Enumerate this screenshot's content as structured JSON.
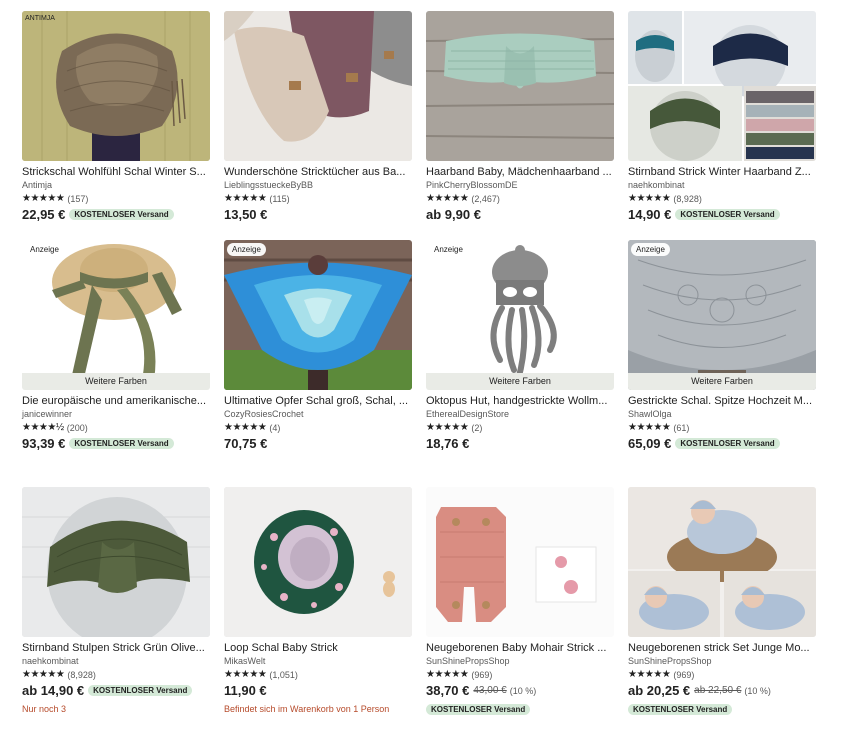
{
  "listings": [
    {
      "title": "Strickschal Wohlfühl Schal Winter S...",
      "shop": "Antimja",
      "rating_count": "(157)",
      "price": "22,95 €",
      "shipping": "KOSTENLOSER Versand"
    },
    {
      "title": "Wunderschöne Stricktücher aus Ba...",
      "shop": "LieblingsstueckeByBB",
      "rating_count": "(115)",
      "price": "13,50 €"
    },
    {
      "title": "Haarband Baby, Mädchenhaarband ...",
      "shop": "PinkCherryBlossomDE",
      "rating_count": "(2,467)",
      "price": "ab 9,90 €"
    },
    {
      "title": "Stirnband Strick Winter Haarband Z...",
      "shop": "naehkombinat",
      "rating_count": "(8,928)",
      "price": "14,90 €",
      "shipping": "KOSTENLOSER Versand"
    },
    {
      "title": "Die europäische und amerikanische...",
      "shop": "janicewinner",
      "rating_count": "(200)",
      "price": "93,39 €",
      "shipping": "KOSTENLOSER Versand",
      "ad": "Anzeige",
      "more_colors": "Weitere Farben",
      "stars": "★★★★½"
    },
    {
      "title": "Ultimative Opfer Schal groß, Schal, ...",
      "shop": "CozyRosiesCrochet",
      "rating_count": "(4)",
      "price": "70,75 €",
      "ad": "Anzeige"
    },
    {
      "title": "Oktopus Hut, handgestrickte Wollm...",
      "shop": "EtherealDesignStore",
      "rating_count": "(2)",
      "price": "18,76 €",
      "ad": "Anzeige",
      "more_colors": "Weitere Farben"
    },
    {
      "title": "Gestrickte Schal. Spitze Hochzeit M...",
      "shop": "ShawlOlga",
      "rating_count": "(61)",
      "price": "65,09 €",
      "shipping": "KOSTENLOSER Versand",
      "ad": "Anzeige",
      "more_colors": "Weitere Farben"
    },
    {
      "title": "Stirnband Stulpen Strick Grün Olive...",
      "shop": "naehkombinat",
      "rating_count": "(8,928)",
      "price": "ab 14,90 €",
      "shipping": "KOSTENLOSER Versand",
      "note": "Nur noch 3"
    },
    {
      "title": "Loop Schal Baby Strick",
      "shop": "MikasWelt",
      "rating_count": "(1,051)",
      "price": "11,90 €",
      "note": "Befindet sich im Warenkorb von 1 Person"
    },
    {
      "title": "Neugeborenen Baby Mohair Strick ...",
      "shop": "SunShinePropsShop",
      "rating_count": "(969)",
      "price": "38,70 €",
      "old_price": "43,00 €",
      "discount": "(10 %)",
      "shipping": "KOSTENLOSER Versand"
    },
    {
      "title": "Neugeborenen strick Set Junge Mo...",
      "shop": "SunShinePropsShop",
      "rating_count": "(969)",
      "price": "ab 20,25 €",
      "old_price": "ab 22,50 €",
      "discount": "(10 %)",
      "shipping": "KOSTENLOSER Versand"
    }
  ],
  "images": {
    "img0_watermark": "ANTIMJA"
  },
  "default_stars": "★★★★★",
  "colors": {
    "ship_badge": "#d4e9d7",
    "note": "#b64b2b"
  }
}
